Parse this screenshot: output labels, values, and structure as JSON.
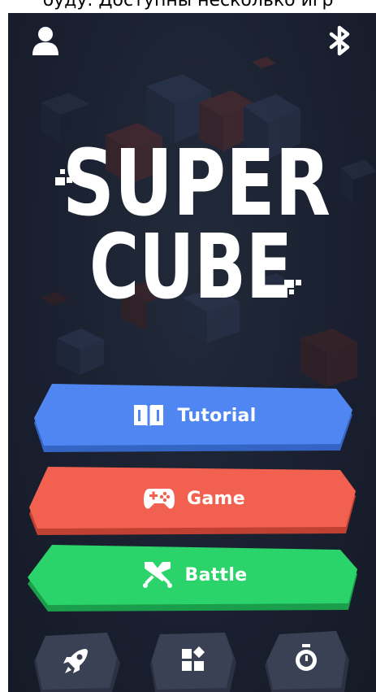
{
  "caption": {
    "text": "буду. Доступны несколько игр"
  },
  "header": {
    "profile_icon": "user-icon",
    "bluetooth_icon": "bluetooth-icon"
  },
  "logo": {
    "line1": "SUPER",
    "line2": "CUBE"
  },
  "menu": {
    "tutorial": {
      "label": "Tutorial",
      "icon": "book-icon",
      "color": "#4f86f1"
    },
    "game": {
      "label": "Game",
      "icon": "gamepad-icon",
      "color": "#f2604f"
    },
    "battle": {
      "label": "Battle",
      "icon": "crossed-swords-icon",
      "color": "#2bd46a"
    }
  },
  "bottom_bar": {
    "items": [
      {
        "icon": "rocket-icon"
      },
      {
        "icon": "grid-icon"
      },
      {
        "icon": "stopwatch-icon"
      }
    ]
  }
}
